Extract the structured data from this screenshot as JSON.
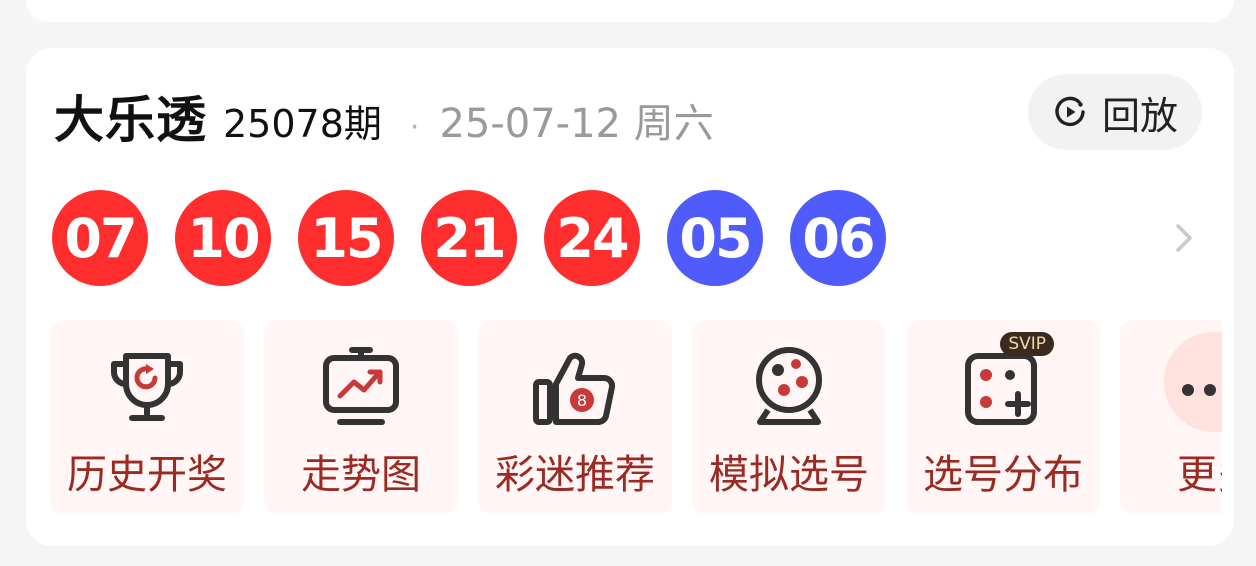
{
  "lottery": {
    "name": "大乐透",
    "issue": "25078期",
    "separator": "·",
    "date": "25-07-12 周六"
  },
  "replay": {
    "label": "回放",
    "icon": "replay-icon"
  },
  "balls": {
    "front": [
      "07",
      "10",
      "15",
      "21",
      "24"
    ],
    "back": [
      "05",
      "06"
    ],
    "front_color": "#ff2e2e",
    "back_color": "#4f5bfa"
  },
  "tools": [
    {
      "label": "历史开奖",
      "icon": "trophy-icon"
    },
    {
      "label": "走势图",
      "icon": "trend-chart-icon"
    },
    {
      "label": "彩迷推荐",
      "icon": "thumbs-up-icon",
      "icon_badge": "8"
    },
    {
      "label": "模拟选号",
      "icon": "lottery-ball-icon"
    },
    {
      "label": "选号分布",
      "icon": "dice-icon",
      "badge": "SVIP"
    },
    {
      "label": "更多",
      "icon": "more-icon"
    }
  ]
}
